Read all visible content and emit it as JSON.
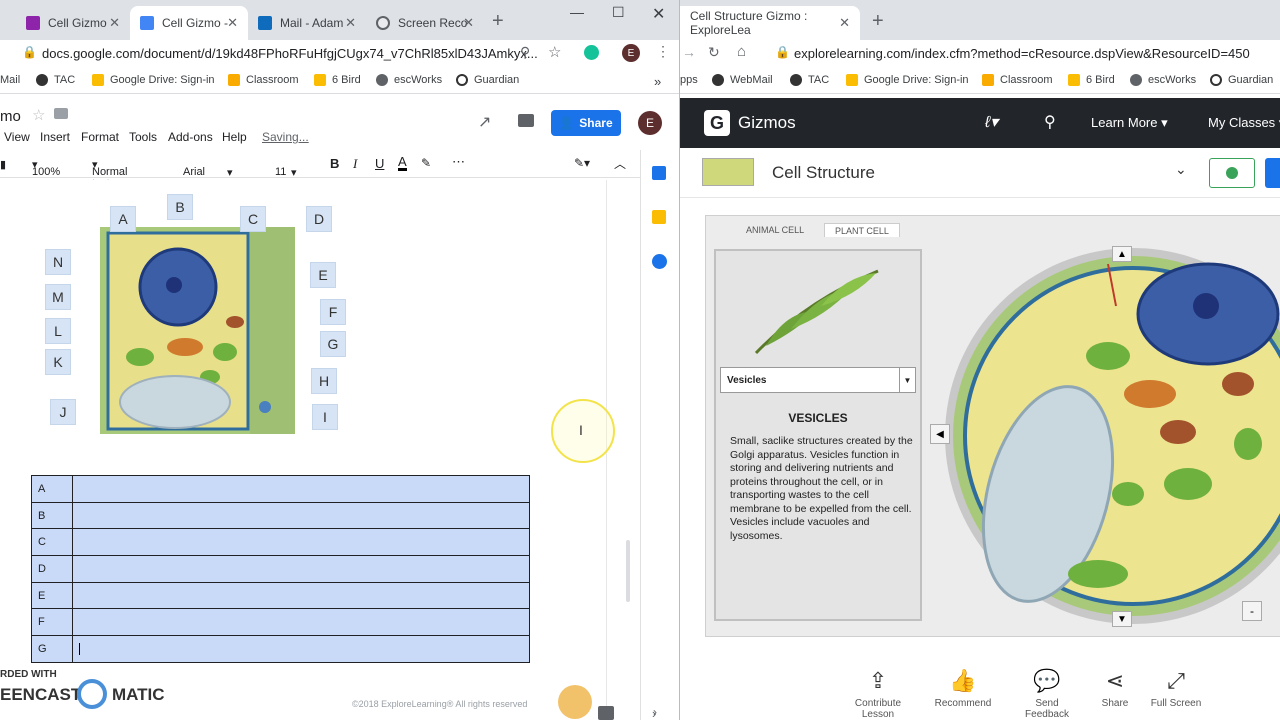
{
  "left_window": {
    "tabs": [
      {
        "title": "Cell Gizmo",
        "color": "#8e24aa"
      },
      {
        "title": "Cell Gizmo -",
        "color": "#4285f4"
      },
      {
        "title": "Mail - Adam",
        "color": "#0f6cbd"
      },
      {
        "title": "Screen Reco",
        "color": "#5f6368"
      }
    ],
    "url": "docs.google.com/document/d/19kd48FPhoRFuHfgjCUgx74_v7ChRl85xlD43JAmkyx...",
    "bookmarks": [
      "Mail",
      "TAC",
      "Google Drive: Sign-in",
      "Classroom",
      "6 Bird",
      "escWorks",
      "Guardian"
    ],
    "doc_title": "mo",
    "menu": [
      "View",
      "Insert",
      "Format",
      "Tools",
      "Add-ons",
      "Help"
    ],
    "saving": "Saving...",
    "share": "Share",
    "avatar": "E",
    "toolbar": {
      "zoom": "100%",
      "style": "Normal text",
      "font": "Arial",
      "size": "11",
      "bold": "B",
      "italic": "I",
      "underline": "U",
      "text_color": "A"
    },
    "diagram_labels": [
      "A",
      "B",
      "C",
      "D",
      "E",
      "F",
      "G",
      "H",
      "I",
      "J",
      "K",
      "L",
      "M",
      "N"
    ],
    "table_rows": [
      "A",
      "B",
      "C",
      "D",
      "E",
      "F",
      "G"
    ],
    "watermark": "RDED WITH",
    "watermark2": "EENCAST",
    "watermark3": "MATIC",
    "copyright": "©2018 ExploreLearning®  All rights reserved"
  },
  "right_window": {
    "tab_title": "Cell Structure Gizmo : ExploreLea",
    "url": "explorelearning.com/index.cfm?method=cResource.dspView&ResourceID=450",
    "bookmarks": [
      "pps",
      "WebMail",
      "TAC",
      "Google Drive: Sign-in",
      "Classroom",
      "6 Bird",
      "escWorks",
      "Guardian"
    ],
    "brand": "Gizmos",
    "nav": [
      "Learn More",
      "My Classes"
    ],
    "page_title": "Cell Structure",
    "gizmo_tabs": [
      "ANIMAL CELL",
      "PLANT CELL"
    ],
    "selected": "Vesicles",
    "heading": "VESICLES",
    "description": "Small, saclike structures created by the Golgi apparatus. Vesicles function in storing and delivering nutrients and proteins throughout the cell, or in transporting wastes to the cell membrane to be expelled from the cell. Vesicles include vacuoles and lysosomes.",
    "bottom": [
      "Contribute Lesson",
      "Recommend",
      "Send Feedback",
      "Share",
      "Full Screen"
    ]
  }
}
